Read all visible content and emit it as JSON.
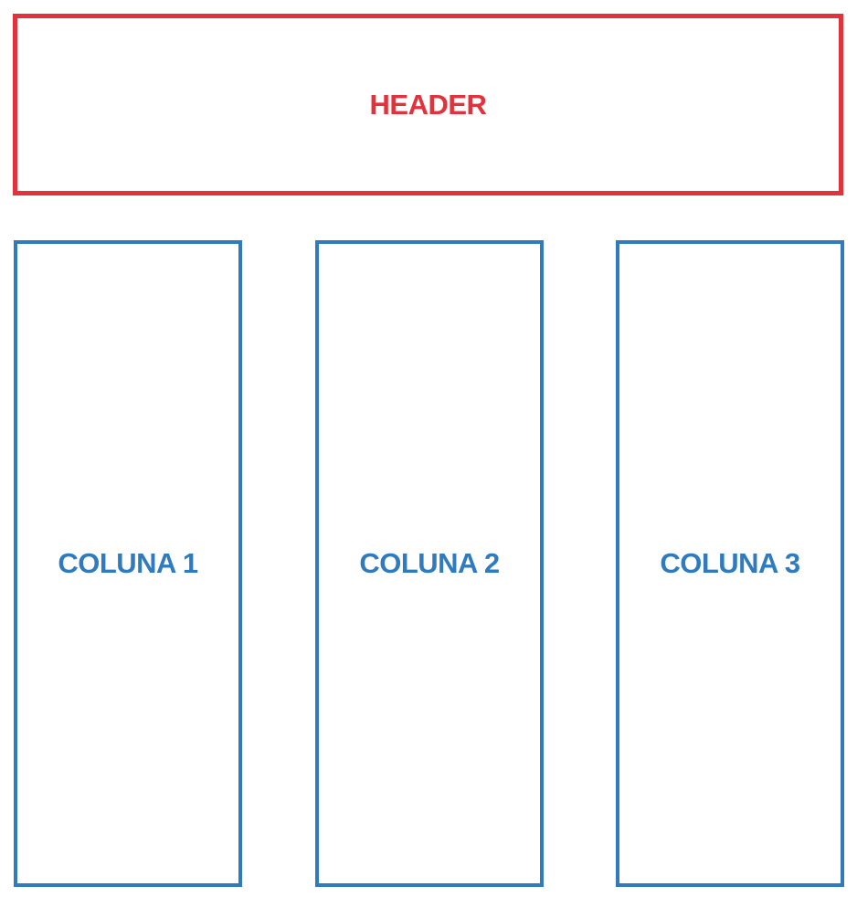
{
  "header": {
    "label": "HEADER"
  },
  "columns": [
    {
      "label": "COLUNA 1"
    },
    {
      "label": "COLUNA 2"
    },
    {
      "label": "COLUNA 3"
    }
  ],
  "colors": {
    "header": "#e0333c",
    "columns": "#2f7bbd",
    "background": "#ffffff"
  }
}
